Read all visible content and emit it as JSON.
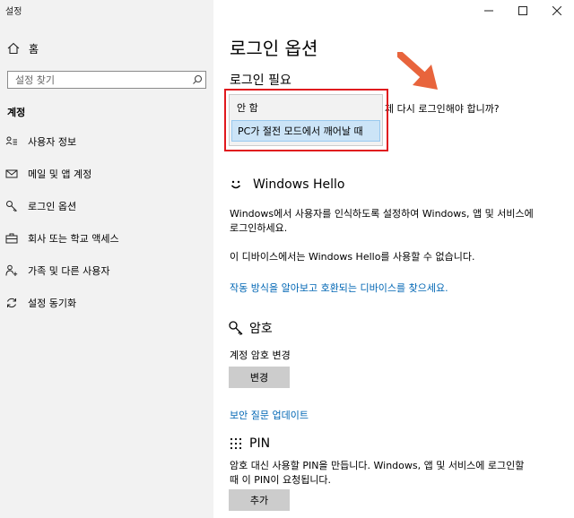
{
  "app_title": "설정",
  "sidebar": {
    "home_label": "홈",
    "search_placeholder": "설정 찾기",
    "section_label": "계정",
    "items": [
      {
        "label": "사용자 정보",
        "icon": "user-info-icon"
      },
      {
        "label": "메일 및 앱 계정",
        "icon": "mail-icon"
      },
      {
        "label": "로그인 옵션",
        "icon": "key-icon"
      },
      {
        "label": "회사 또는 학교 액세스",
        "icon": "briefcase-icon"
      },
      {
        "label": "가족 및 다른 사용자",
        "icon": "family-icon"
      },
      {
        "label": "설정 동기화",
        "icon": "sync-icon"
      }
    ]
  },
  "main": {
    "title": "로그인 옵션",
    "require_signin": {
      "heading": "로그인 필요",
      "question_partial": "제 다시 로그인해야 합니까?",
      "options": [
        "안 함",
        "PC가 절전 모드에서 깨어날 때"
      ],
      "selected_index": 1
    },
    "windows_hello": {
      "heading": "Windows Hello",
      "description": "Windows에서 사용자를 인식하도록 설정하여 Windows, 앱 및 서비스에 로그인하세요.",
      "unavailable": "이 디바이스에서는 Windows Hello를 사용할 수 없습니다.",
      "link": "작동 방식을 알아보고 호환되는 디바이스를 찾으세요."
    },
    "password": {
      "heading": "암호",
      "change_label": "계정 암호 변경",
      "change_button": "변경",
      "security_link": "보안 질문 업데이트"
    },
    "pin": {
      "heading": "PIN",
      "description": "암호 대신 사용할 PIN을 만듭니다. Windows, 앱 및 서비스에 로그인할 때 이 PIN이 요청됩니다.",
      "add_button": "추가"
    }
  },
  "colors": {
    "highlight_box": "#e0191e",
    "arrow": "#e8643c",
    "link": "#0066b4",
    "sidebar_bg": "#f2f2f2",
    "selected_option": "#cce4f7"
  }
}
